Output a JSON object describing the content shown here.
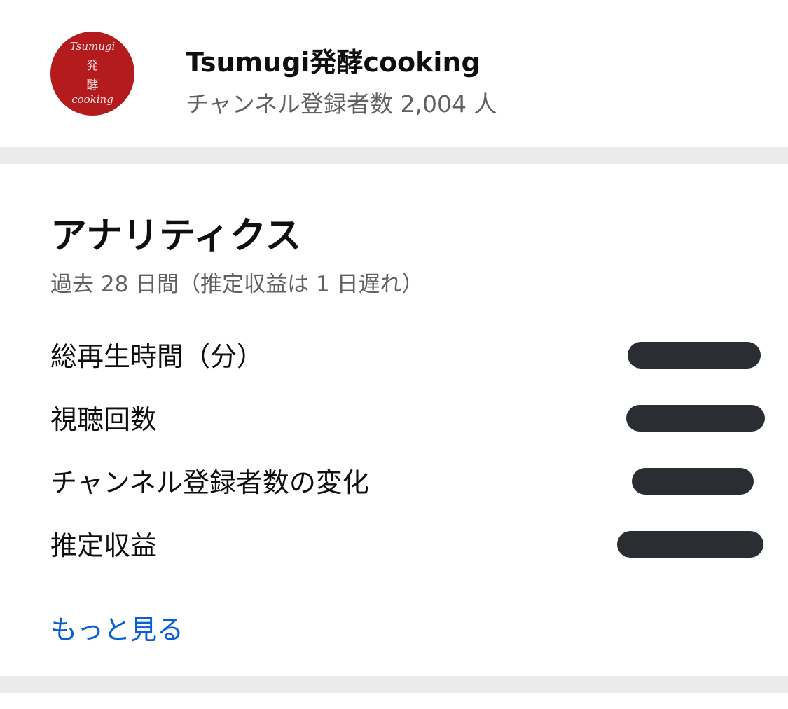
{
  "channel": {
    "name": "Tsumugi発酵cooking",
    "subscribers": "チャンネル登録者数 2,004 人",
    "avatar": {
      "line1": "Tsumugi",
      "line2": "発",
      "line3": "酵",
      "line4": "cooking",
      "color": "#b41b1c"
    }
  },
  "analytics": {
    "title": "アナリティクス",
    "subtitle": "過去 28 日間（推定収益は 1 日遅れ）",
    "metrics": [
      {
        "label": "総再生時間（分）",
        "value": ""
      },
      {
        "label": "視聴回数",
        "value": ""
      },
      {
        "label": "チャンネル登録者数の変化",
        "value": ""
      },
      {
        "label": "推定収益",
        "value": ""
      }
    ],
    "see_more": "もっと見る"
  },
  "colors": {
    "link": "#065fd4",
    "redaction": "#2a2d31",
    "divider": "#ebebeb"
  }
}
